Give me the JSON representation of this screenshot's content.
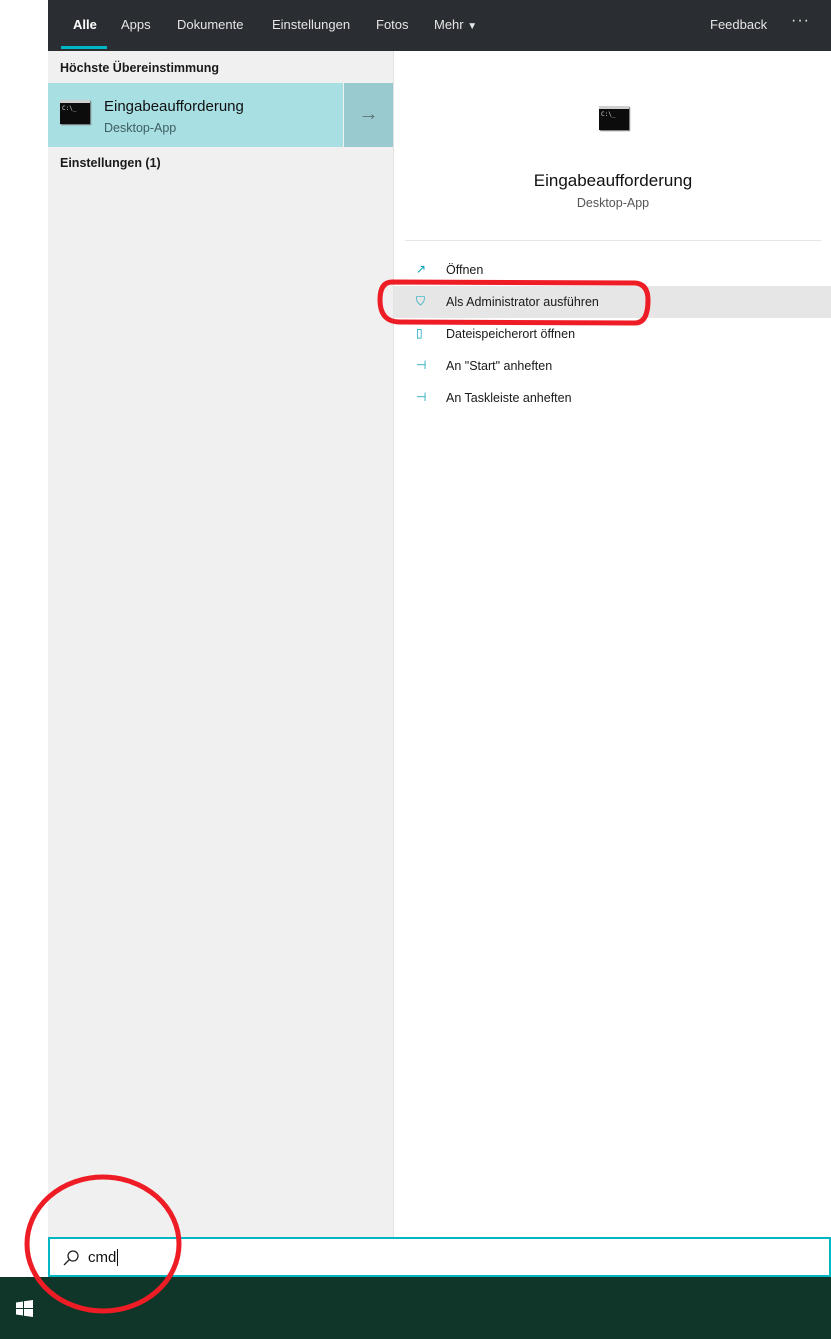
{
  "tabs": [
    {
      "label": "Alle",
      "active": true
    },
    {
      "label": "Apps"
    },
    {
      "label": "Dokumente"
    },
    {
      "label": "Einstellungen"
    },
    {
      "label": "Fotos"
    },
    {
      "label": "Mehr"
    }
  ],
  "feedback": "Feedback",
  "more_icon": "ellipsis-icon",
  "left": {
    "best_match_header": "Höchste Übereinstimmung",
    "best_match": {
      "title": "Eingabeaufforderung",
      "subtitle": "Desktop-App",
      "icon_text": "C:\\_"
    },
    "settings_header": "Einstellungen (1)"
  },
  "right": {
    "title": "Eingabeaufforderung",
    "subtitle": "Desktop-App",
    "icon_text": "C:\\_",
    "actions": [
      {
        "label": "Öffnen",
        "icon": "open-icon"
      },
      {
        "label": "Als Administrator ausführen",
        "icon": "admin-shield-icon",
        "highlighted": true
      },
      {
        "label": "Dateispeicherort öffnen",
        "icon": "file-location-icon"
      },
      {
        "label": "An \"Start\" anheften",
        "icon": "pin-icon"
      },
      {
        "label": "An Taskleiste anheften",
        "icon": "pin-icon"
      }
    ]
  },
  "search": {
    "value": "cmd"
  },
  "colors": {
    "accent": "#00b7c3",
    "selected": "#a8dfe3",
    "taskbar": "#10362a",
    "annotation": "#ee1c25"
  }
}
